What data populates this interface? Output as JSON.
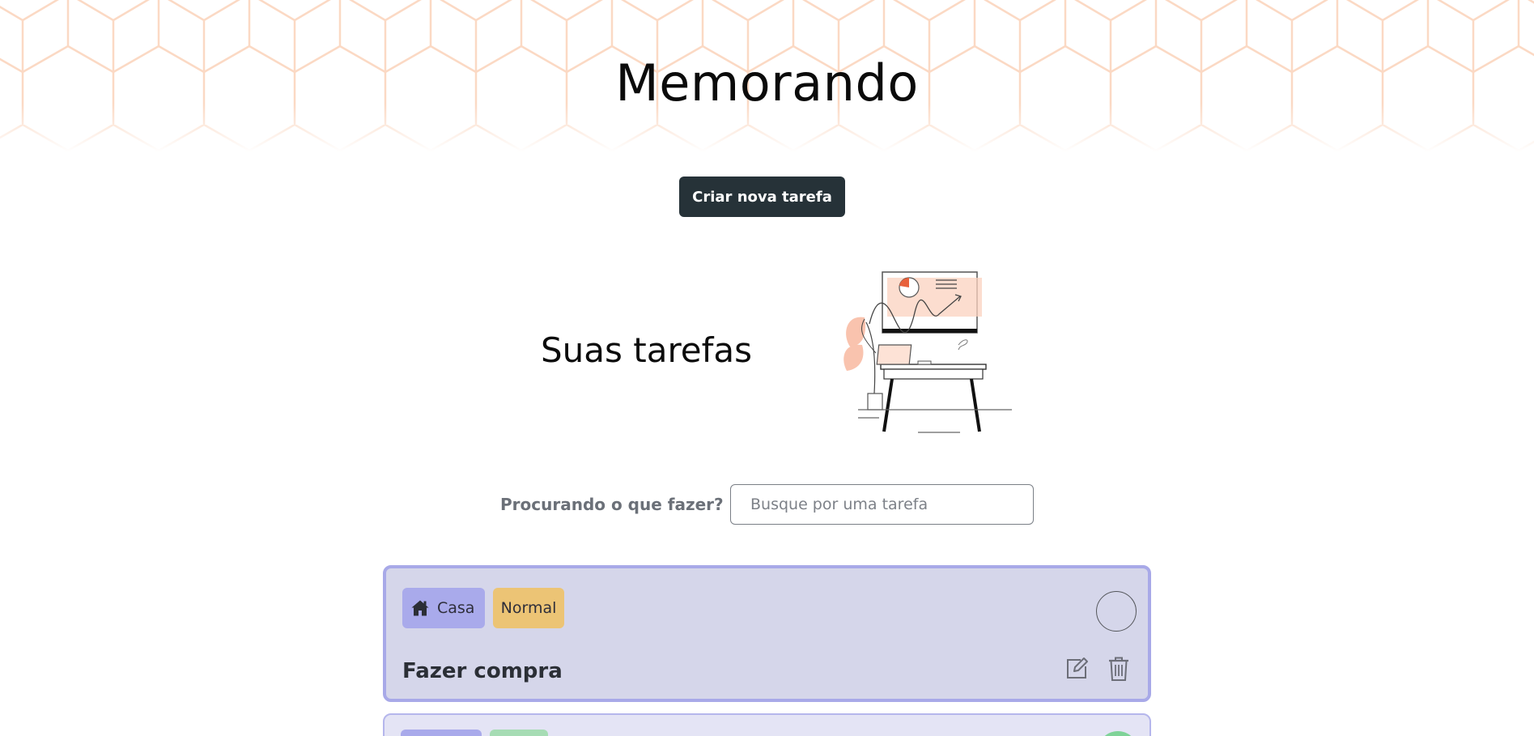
{
  "header": {
    "title": "Memorando"
  },
  "actions": {
    "new_task_label": "Criar nova tarefa"
  },
  "tasks_section": {
    "title": "Suas tarefas"
  },
  "search": {
    "label": "Procurando o que fazer?",
    "placeholder": "Busque por uma tarefa",
    "value": ""
  },
  "tasks": [
    {
      "category": "Casa",
      "category_icon": "house-icon",
      "priority": "Normal",
      "title": "Fazer compra",
      "completed": false,
      "card_color": "#d5d6ea",
      "border_color": "#a8a9e8",
      "category_color": "#a9aaeb",
      "priority_color": "#ecc475"
    },
    {
      "category_color": "#a9aaeb",
      "priority_color": "#a6dcb4",
      "completed": true
    }
  ],
  "colors": {
    "button_bg": "#263238",
    "pattern_stroke": "#fbd9c4",
    "illustration_accent": "#f5b48e"
  }
}
